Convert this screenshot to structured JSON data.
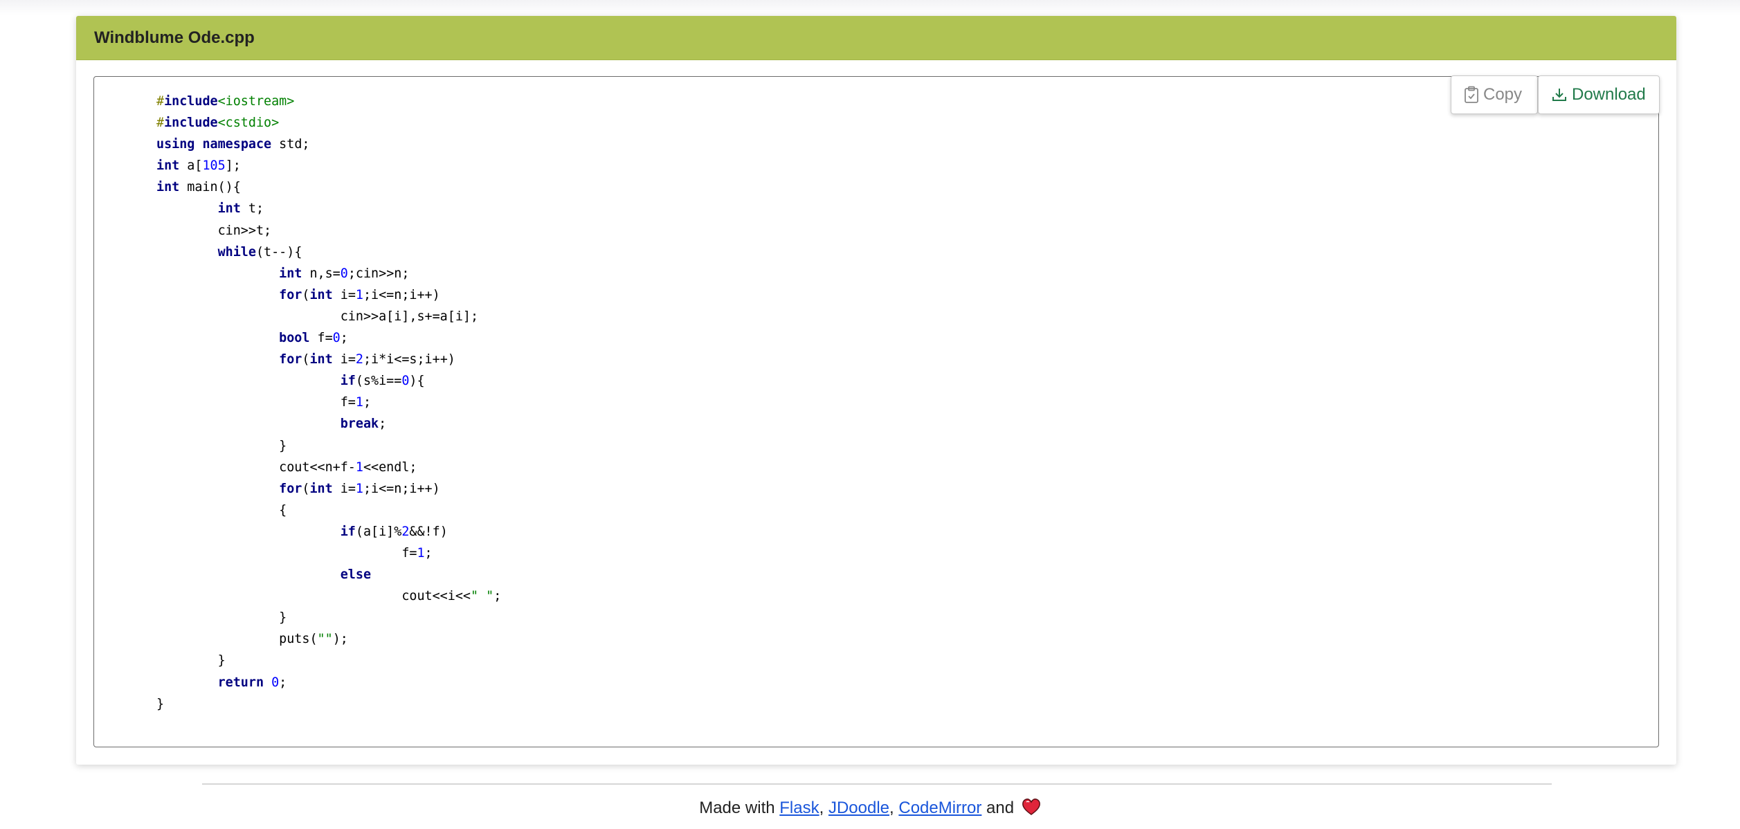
{
  "card": {
    "title": "Windblume Ode.cpp"
  },
  "toolbar": {
    "copy_label": "Copy",
    "download_label": "Download"
  },
  "icons": {
    "copy": "clipboard-icon",
    "download": "download-icon",
    "heart": "heart-icon"
  },
  "colors": {
    "header_bg": "#b0c353",
    "keyword": "#000080",
    "number": "#0000ff",
    "string": "#008000",
    "preprocessor": "#808000",
    "download_text": "#217a4a",
    "link": "#1a56db"
  },
  "code_lines": [
    [
      [
        "pre",
        "#"
      ],
      [
        "kw",
        "include"
      ],
      [
        "str",
        "<iostream>"
      ]
    ],
    [
      [
        "pre",
        "#"
      ],
      [
        "kw",
        "include"
      ],
      [
        "str",
        "<cstdio>"
      ]
    ],
    [
      [
        "kw",
        "using"
      ],
      [
        "",
        " "
      ],
      [
        "kw",
        "namespace"
      ],
      [
        "",
        " std;"
      ]
    ],
    [
      [
        "kw",
        "int"
      ],
      [
        "",
        " a["
      ],
      [
        "num",
        "105"
      ],
      [
        "",
        "];"
      ]
    ],
    [
      [
        "kw",
        "int"
      ],
      [
        "",
        " main(){"
      ]
    ],
    [
      [
        "",
        "\tint"
      ],
      [
        "",
        " t;"
      ]
    ],
    [
      [
        "",
        "\tcin>>t;"
      ]
    ],
    [
      [
        "",
        "\twhile"
      ],
      [
        "",
        "(t--){"
      ]
    ],
    [
      [
        "",
        "\t\tint"
      ],
      [
        "",
        " n,s="
      ],
      [
        "num",
        "0"
      ],
      [
        "",
        ";cin>>n;"
      ]
    ],
    [
      [
        "",
        "\t\tfor"
      ],
      [
        "",
        "("
      ],
      [
        "kw",
        "int"
      ],
      [
        "",
        " i="
      ],
      [
        "num",
        "1"
      ],
      [
        "",
        ";i<=n;i++)"
      ]
    ],
    [
      [
        "",
        "\t\t\tcin>>a[i],s+=a[i];"
      ]
    ],
    [
      [
        "",
        "\t\tbool"
      ],
      [
        "",
        " f="
      ],
      [
        "num",
        "0"
      ],
      [
        "",
        ";"
      ]
    ],
    [
      [
        "",
        "\t\tfor"
      ],
      [
        "",
        "("
      ],
      [
        "kw",
        "int"
      ],
      [
        "",
        " i="
      ],
      [
        "num",
        "2"
      ],
      [
        "",
        ";i*i<=s;i++)"
      ]
    ],
    [
      [
        "",
        "\t\t\tif"
      ],
      [
        "",
        "(s%i=="
      ],
      [
        "num",
        "0"
      ],
      [
        "",
        "){"
      ]
    ],
    [
      [
        "",
        "\t\t\tf="
      ],
      [
        "num",
        "1"
      ],
      [
        "",
        ";"
      ]
    ],
    [
      [
        "",
        "\t\t\tbreak"
      ],
      [
        "",
        ";"
      ]
    ],
    [
      [
        "",
        "\t\t}"
      ]
    ],
    [
      [
        "",
        "\t\tcout<<n+f-"
      ],
      [
        "num",
        "1"
      ],
      [
        "",
        "<<endl;"
      ]
    ],
    [
      [
        "",
        "\t\tfor"
      ],
      [
        "",
        "("
      ],
      [
        "kw",
        "int"
      ],
      [
        "",
        " i="
      ],
      [
        "num",
        "1"
      ],
      [
        "",
        ";i<=n;i++)"
      ]
    ],
    [
      [
        "",
        "\t\t{"
      ]
    ],
    [
      [
        "",
        "\t\t\tif"
      ],
      [
        "",
        "(a[i]%"
      ],
      [
        "num",
        "2"
      ],
      [
        "",
        "&&!f)"
      ]
    ],
    [
      [
        "",
        "\t\t\t\tf="
      ],
      [
        "num",
        "1"
      ],
      [
        "",
        ";"
      ]
    ],
    [
      [
        "",
        "\t\t\telse"
      ]
    ],
    [
      [
        "",
        "\t\t\t\tcout<<i<<"
      ],
      [
        "str",
        "\" \""
      ],
      [
        "",
        ";"
      ]
    ],
    [
      [
        "",
        "\t\t}"
      ]
    ],
    [
      [
        "",
        "\t\tputs("
      ],
      [
        "str",
        "\"\""
      ],
      [
        "",
        ");"
      ]
    ],
    [
      [
        "",
        "\t}"
      ]
    ],
    [
      [
        "",
        "\treturn"
      ],
      [
        "",
        " "
      ],
      [
        "num",
        "0"
      ],
      [
        "",
        ";"
      ]
    ],
    [
      [
        "",
        "}"
      ]
    ]
  ],
  "footer": {
    "prefix": "Made with ",
    "link1": "Flask",
    "sep1": ", ",
    "link2": "JDoodle",
    "sep2": ", ",
    "link3": "CodeMirror",
    "suffix": " and "
  }
}
